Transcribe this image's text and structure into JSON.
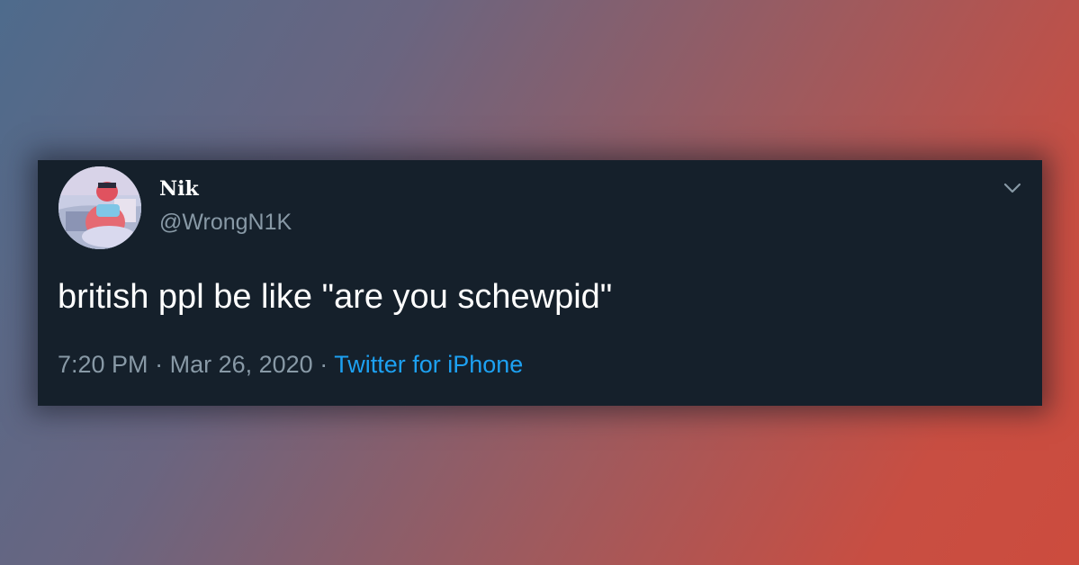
{
  "tweet": {
    "author": {
      "display_name": "Nik",
      "handle": "@WrongN1K",
      "avatar_icon": "avatar-image"
    },
    "text": "british ppl be like \"are you schewpid\"",
    "meta": {
      "time": "7:20 PM",
      "separator": "·",
      "date": "Mar 26, 2020",
      "source": "Twitter for iPhone"
    },
    "menu_icon": "chevron-down-icon"
  },
  "colors": {
    "card_background": "#15202b",
    "primary_text": "#ffffff",
    "secondary_text": "#8899a6",
    "link": "#1da1f2"
  }
}
